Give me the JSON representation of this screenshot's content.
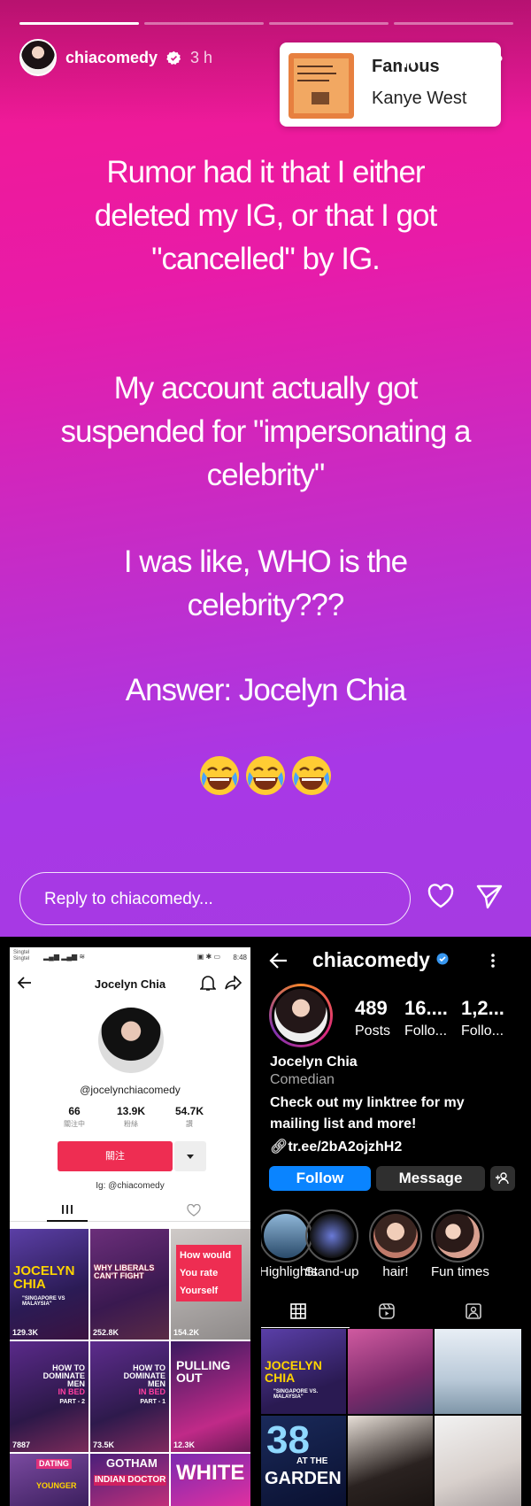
{
  "story": {
    "username": "chiacomedy",
    "time": "3 h",
    "music": {
      "title": "Famous",
      "artist": "Kanye West"
    },
    "text_blocks": [
      {
        "lines": [
          "Rumor had it that I either",
          "deleted my IG, or that I got",
          "\"cancelled\" by IG."
        ]
      },
      {
        "lines": [
          "My account actually got",
          "suspended for \"impersonating a",
          "celebrity\""
        ]
      },
      {
        "lines": [
          "I was like, WHO is the",
          "celebrity???"
        ]
      },
      {
        "lines": [
          "Answer: Jocelyn Chia"
        ]
      }
    ],
    "emoji_count": 3,
    "reply_placeholder": "Reply to chiacomedy...",
    "progress_filled": [
      1,
      0,
      0,
      0
    ]
  },
  "tiktok": {
    "status_signal": [
      "Singtel",
      "Singtel"
    ],
    "status_time": "8:48",
    "profile_name": "Jocelyn Chia",
    "handle": "@jocelynchiacomedy",
    "stats": [
      {
        "value": "66",
        "label": "關注中"
      },
      {
        "value": "13.9K",
        "label": "粉絲"
      },
      {
        "value": "54.7K",
        "label": "讚"
      }
    ],
    "follow_label": "關注",
    "bio": "Ig: @chiacomedy",
    "videos": [
      {
        "views": "129.3K",
        "caption_lines": [
          "JOCELYN",
          "CHIA"
        ],
        "sub": "\"SINGAPORE VS MALAYSIA\""
      },
      {
        "views": "252.8K",
        "caption_lines": [
          "WHY LIBERALS",
          "CAN'T FIGHT"
        ],
        "sub": ""
      },
      {
        "views": "154.2K",
        "caption_lines": [
          "How would",
          "You rate",
          "Yourself"
        ],
        "sub": ""
      },
      {
        "views": "7887",
        "caption_lines": [
          "HOW TO",
          "DOMINATE MEN",
          "IN BED"
        ],
        "sub": "PART - 2"
      },
      {
        "views": "73.5K",
        "caption_lines": [
          "HOW TO",
          "DOMINATE MEN",
          "IN BED"
        ],
        "sub": "PART - 1"
      },
      {
        "views": "12.3K",
        "caption_lines": [
          "PULLING",
          "OUT"
        ],
        "sub": ""
      },
      {
        "views": "",
        "caption_lines": [
          "DATING",
          "YOUNGER"
        ],
        "sub": ""
      },
      {
        "views": "",
        "caption_lines": [
          "GOTHAM",
          "INDIAN DOCTOR"
        ],
        "sub": ""
      },
      {
        "views": "",
        "caption_lines": [
          "WHITE"
        ],
        "sub": ""
      }
    ]
  },
  "instagram": {
    "username": "chiacomedy",
    "stats": [
      {
        "value": "489",
        "label": "Posts"
      },
      {
        "value": "16....",
        "label": "Follo..."
      },
      {
        "value": "1,2...",
        "label": "Follo..."
      }
    ],
    "name": "Jocelyn Chia",
    "category": "Comedian",
    "bio_lines": [
      "Check out my linktree for my",
      "mailing list and more!"
    ],
    "link": "tr.ee/2bA2ojzhH2",
    "follow_label": "Follow",
    "message_label": "Message",
    "highlights": [
      "Highlights",
      "Stand-up",
      "hair!",
      "Fun times"
    ],
    "posts": [
      {
        "caption_lines": [
          "JOCELYN",
          "CHIA"
        ],
        "sub": "\"SINGAPORE VS. MALAYSIA\""
      },
      {
        "caption_lines": [],
        "sub": ""
      },
      {
        "caption_lines": [],
        "sub": ""
      },
      {
        "caption_lines": [
          "38",
          "AT THE",
          "GARDEN"
        ],
        "sub": ""
      },
      {
        "caption_lines": [],
        "sub": ""
      },
      {
        "caption_lines": [],
        "sub": ""
      }
    ]
  },
  "colors": {
    "tiktok_red": "#ee2d52",
    "ig_blue": "#0a84ff",
    "story_gradient_top": "#f4198e",
    "story_gradient_bottom": "#a63ae2"
  },
  "icons": [
    "verified-icon",
    "pause-icon",
    "muted-icon",
    "more-icon",
    "heart-icon",
    "send-icon",
    "back-icon",
    "bell-icon",
    "share-icon",
    "grid-icon",
    "reels-icon",
    "tagged-icon",
    "link-icon",
    "add-user-icon",
    "laughing-emoji-icon"
  ]
}
